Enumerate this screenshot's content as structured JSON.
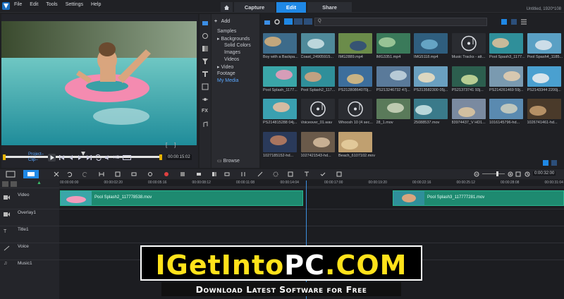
{
  "menu": [
    "File",
    "Edit",
    "Tools",
    "Settings",
    "Help"
  ],
  "tabs": {
    "capture": "Capture",
    "edit": "Edit",
    "share": "Share"
  },
  "window_title": "Untitled, 1920*108",
  "player": {
    "project_label": "Project–",
    "clip_label": "Clip–",
    "hd": "HD",
    "timecode": "00:00:15:02"
  },
  "library": {
    "add_label": "Add",
    "nav": {
      "samples": "Samples",
      "backgrounds": "Backgrounds",
      "solid_colors": "Solid Colors",
      "images": "Images",
      "videos": "Videos",
      "video": "Video",
      "footage": "Footage",
      "my_media": "My Media"
    },
    "browse": "Browse",
    "search_placeholder": "Q"
  },
  "thumbnails": [
    "Boy with a Backpa...",
    "Coast_24905915...",
    "IMG2889.mp4",
    "IMG3351.mp4",
    "IMG5118.mp4",
    "Music Tracks - att...",
    "Pool Spash3_1177...",
    "Pool Spash4_1185...",
    "Pool Splash_1177...",
    "Pool Splash2_117...",
    "PS21280864070j...",
    "PS213246732 47j...",
    "PS213582300 05j...",
    "PS21373741 93j...",
    "PS214261469 59j...",
    "PS2143344 2200j...",
    "PS214815288 04j...",
    "Voiceover_01.wav",
    "Whoosh 10 (4 sec...",
    "28_1.mov",
    "25088537.mov",
    "83974437_V HD1...",
    "1016145796-hd...",
    "1026741461-hd...",
    "1027185152-hd...",
    "1027421543-hd...",
    "Beach_6107102.mov"
  ],
  "timeline": {
    "ruler": [
      "00:00:00:00",
      "00:00:02:20",
      "00:00:05:16",
      "00:00:08:12",
      "00:00:11:08",
      "00:00:14:04",
      "00:00:17:00",
      "00:00:19:20",
      "00:00:22:16",
      "00:00:25:12",
      "00:00:28:08",
      "00:00:31:04"
    ],
    "duration": "0:00:32:00",
    "tracks": [
      "Video",
      "Overlay1",
      "Title1",
      "Voice",
      "Music1"
    ],
    "clips": [
      "Pool Splash2_117778538.mov",
      "Pool Splash3_117777281.mov"
    ]
  },
  "watermark": {
    "part1": "IGetInto",
    "part2": "PC",
    "part3": ".com",
    "subtitle": "Download Latest Software for Free"
  },
  "colors": {
    "accent": "#1f88e5",
    "clip": "#1e8a70",
    "watermark_yellow": "#ffe21a"
  }
}
